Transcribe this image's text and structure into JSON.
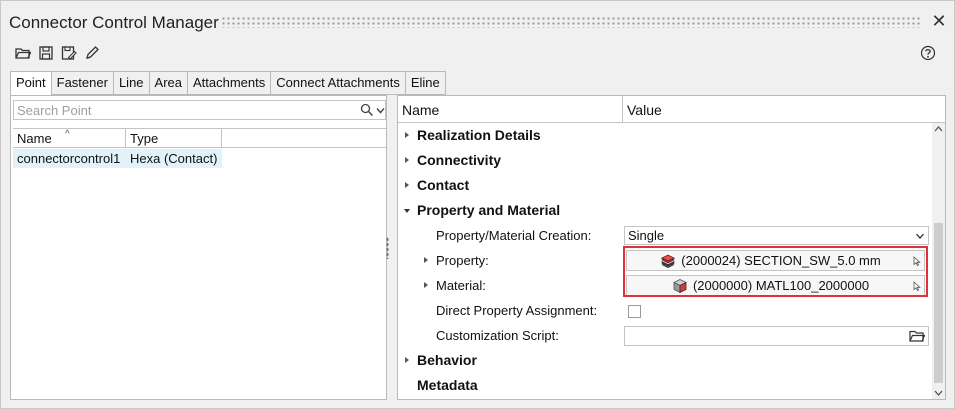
{
  "window": {
    "title": "Connector Control Manager"
  },
  "tabs": [
    "Point",
    "Fastener",
    "Line",
    "Area",
    "Attachments",
    "Connect Attachments",
    "Eline"
  ],
  "left": {
    "search_placeholder": "Search Point",
    "columns": {
      "name": "Name",
      "type": "Type"
    },
    "rows": [
      {
        "name": "connectorcontrol1",
        "type": "Hexa (Contact)"
      }
    ]
  },
  "right": {
    "columns": {
      "name": "Name",
      "value": "Value"
    },
    "groups": {
      "realization": "Realization Details",
      "connectivity": "Connectivity",
      "contact": "Contact",
      "property_material": "Property and Material",
      "behavior": "Behavior",
      "metadata": "Metadata"
    },
    "props": {
      "creation_label": "Property/Material Creation:",
      "creation_value": "Single",
      "property_label": "Property:",
      "property_value": "(2000024) SECTION_SW_5.0 mm",
      "material_label": "Material:",
      "material_value": "(2000000) MATL100_2000000",
      "direct_label": "Direct Property Assignment:",
      "script_label": "Customization Script:"
    }
  },
  "colors": {
    "selection": "#e1f2fb",
    "highlight_box": "#e0303a"
  }
}
